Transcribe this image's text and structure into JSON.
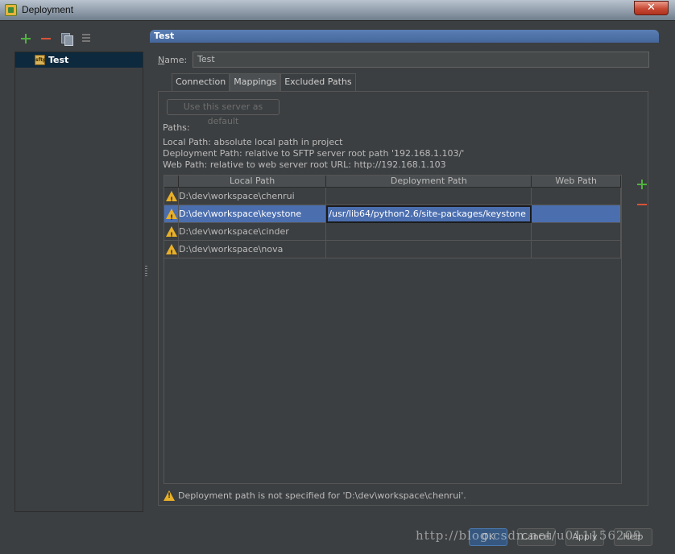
{
  "window": {
    "title": "Deployment",
    "close_label": "✕"
  },
  "left": {
    "servers": [
      {
        "name": "Test",
        "icon": "sftp-icon",
        "icon_text": "sftp",
        "selected": true
      }
    ]
  },
  "right": {
    "header": "Test",
    "name_label_char": "N",
    "name_label_rest": "ame:",
    "name_value": "Test",
    "tabs": [
      {
        "label": "Connection",
        "active": false
      },
      {
        "label": "Mappings",
        "active": true
      },
      {
        "label": "Excluded Paths",
        "active": false
      }
    ],
    "default_button": "Use this server as default",
    "paths_title": "Paths:",
    "paths_info": [
      "Local Path: absolute local path in project",
      "Deployment Path: relative to SFTP server root path '192.168.1.103/'",
      "Web Path: relative to web server root URL: http://192.168.1.103"
    ],
    "table": {
      "columns": [
        "Local Path",
        "Deployment Path",
        "Web Path"
      ],
      "rows": [
        {
          "local": "D:\\dev\\workspace\\chenrui",
          "deploy": "",
          "web": ""
        },
        {
          "local": "D:\\dev\\workspace\\keystone",
          "deploy": "/usr/lib64/python2.6/site-packages/keystone",
          "web": ""
        },
        {
          "local": "D:\\dev\\workspace\\cinder",
          "deploy": "",
          "web": ""
        },
        {
          "local": "D:\\dev\\workspace\\nova",
          "deploy": "",
          "web": ""
        }
      ]
    },
    "status": "Deployment path is not specified for 'D:\\dev\\workspace\\chenrui'."
  },
  "buttons": {
    "ok": "OK",
    "cancel": "Cancel",
    "apply": "Apply",
    "help": "Help"
  },
  "watermark": "http://blog.csdn.net/u011156209",
  "colors": {
    "selection": "#4b6eaf",
    "header": "#4f73a8",
    "warning": "#e8b028",
    "add": "#4fb33f",
    "remove": "#d9533b"
  }
}
